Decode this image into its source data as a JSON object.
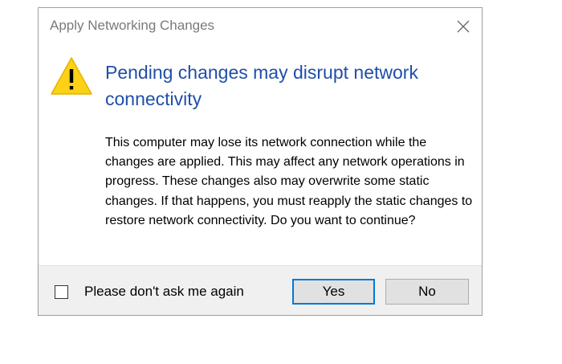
{
  "window": {
    "title": "Apply Networking Changes"
  },
  "content": {
    "headline": "Pending changes may disrupt network connectivity",
    "message": "This computer may lose its network connection while the changes are applied. This may affect any network operations in progress. These changes also may overwrite some static changes. If that happens, you must reapply the static changes to restore network connectivity. Do you want to continue?"
  },
  "footer": {
    "checkbox_label": "Please don't ask me again",
    "checkbox_checked": false,
    "yes_label": "Yes",
    "no_label": "No"
  },
  "colors": {
    "headline": "#1f4fa8",
    "warning_fill": "#fcd116",
    "focus_border": "#0078d7",
    "footer_bg": "#f0f0f0"
  },
  "icons": {
    "warning": "warning-triangle-icon",
    "close": "close-icon"
  }
}
